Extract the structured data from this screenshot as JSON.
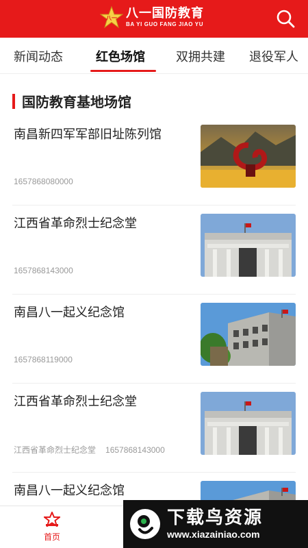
{
  "header": {
    "logo_cn": "八一国防教育",
    "logo_en": "BA YI GUO FANG JIAO YU",
    "search_icon": "search-icon"
  },
  "tabs": [
    {
      "label": "新闻动态",
      "active": false
    },
    {
      "label": "红色场馆",
      "active": true
    },
    {
      "label": "双拥共建",
      "active": false
    },
    {
      "label": "退役军人",
      "active": false
    }
  ],
  "section": {
    "title": "国防教育基地场馆"
  },
  "items": [
    {
      "title": "南昌新四军军部旧址陈列馆",
      "source": "",
      "timestamp": "1657868080000",
      "thumb": "monument-sculpture"
    },
    {
      "title": "江西省革命烈士纪念堂",
      "source": "",
      "timestamp": "1657868143000",
      "thumb": "memorial-hall"
    },
    {
      "title": "南昌八一起义纪念馆",
      "source": "",
      "timestamp": "1657868119000",
      "thumb": "museum-building"
    },
    {
      "title": "江西省革命烈士纪念堂",
      "source": "江西省革命烈士纪念堂",
      "timestamp": "1657868143000",
      "thumb": "memorial-hall"
    },
    {
      "title": "南昌八一起义纪念馆",
      "source": "",
      "timestamp": "",
      "thumb": "museum-building"
    }
  ],
  "bottom_nav": {
    "home_label": "首页"
  },
  "watermark": {
    "cn": "下载鸟资源",
    "url": "www.xiazainiao.com"
  },
  "colors": {
    "brand": "#e61a1a"
  }
}
